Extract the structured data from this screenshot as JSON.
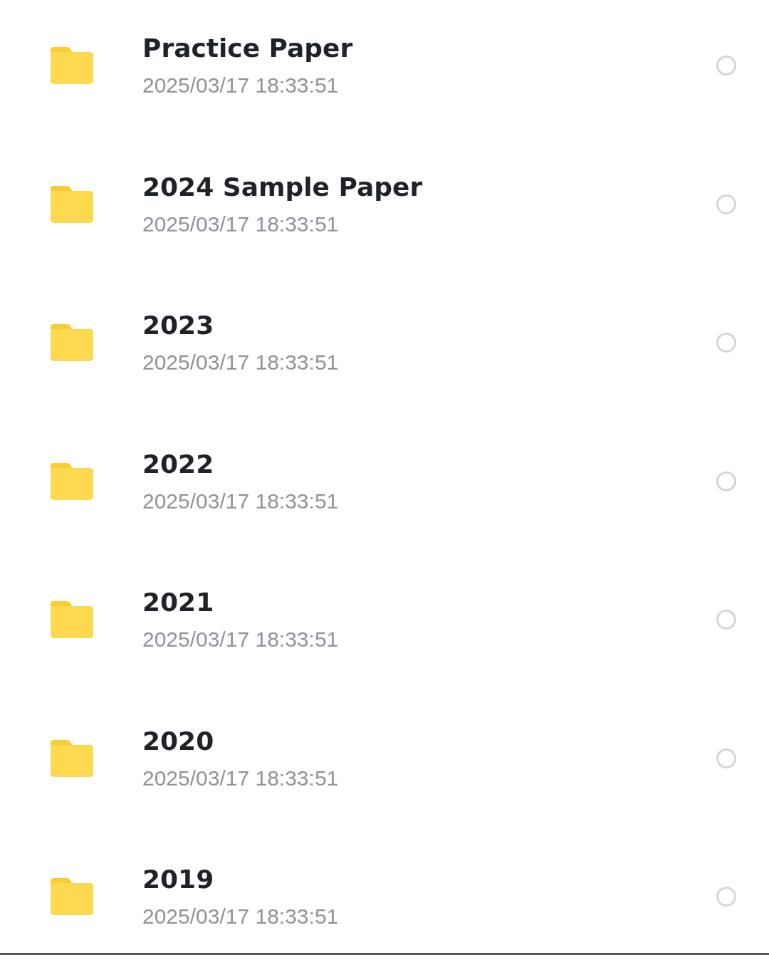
{
  "folders": [
    {
      "name": "Practice Paper",
      "date": "2025/03/17 18:33:51",
      "selected": false
    },
    {
      "name": "2024 Sample Paper",
      "date": "2025/03/17 18:33:51",
      "selected": false
    },
    {
      "name": "2023",
      "date": "2025/03/17 18:33:51",
      "selected": false
    },
    {
      "name": "2022",
      "date": "2025/03/17 18:33:51",
      "selected": false
    },
    {
      "name": "2021",
      "date": "2025/03/17 18:33:51",
      "selected": false
    },
    {
      "name": "2020",
      "date": "2025/03/17 18:33:51",
      "selected": false
    },
    {
      "name": "2019",
      "date": "2025/03/17 18:33:51",
      "selected": false
    }
  ]
}
